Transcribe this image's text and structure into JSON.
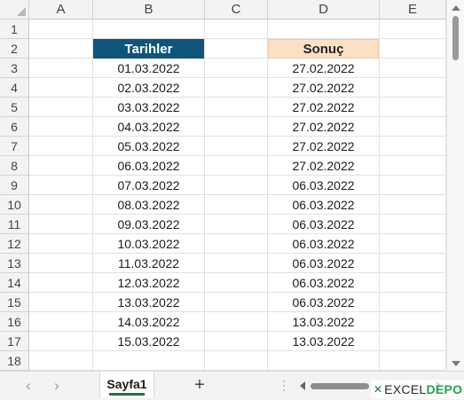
{
  "columns": [
    "A",
    "B",
    "C",
    "D",
    "E"
  ],
  "rows": [
    "1",
    "2",
    "3",
    "4",
    "5",
    "6",
    "7",
    "8",
    "9",
    "10",
    "11",
    "12",
    "13",
    "14",
    "15",
    "16",
    "17",
    "18"
  ],
  "table": {
    "header_b": "Tarihler",
    "header_d": "Sonuç",
    "tarihler": [
      "01.03.2022",
      "02.03.2022",
      "03.03.2022",
      "04.03.2022",
      "05.03.2022",
      "06.03.2022",
      "07.03.2022",
      "08.03.2022",
      "09.03.2022",
      "10.03.2022",
      "11.03.2022",
      "12.03.2022",
      "13.03.2022",
      "14.03.2022",
      "15.03.2022"
    ],
    "sonuc": [
      "27.02.2022",
      "27.02.2022",
      "27.02.2022",
      "27.02.2022",
      "27.02.2022",
      "27.02.2022",
      "06.03.2022",
      "06.03.2022",
      "06.03.2022",
      "06.03.2022",
      "06.03.2022",
      "06.03.2022",
      "06.03.2022",
      "13.03.2022",
      "13.03.2022"
    ]
  },
  "sheet_tab": "Sayfa1",
  "nav": {
    "prev": "‹",
    "next": "›",
    "add": "+",
    "dots": "⋮"
  },
  "watermark": {
    "part1": "EXCEL",
    "part2": "DEPO"
  },
  "colors": {
    "header_b_bg": "#0f5479",
    "header_d_bg": "#fbe0c5",
    "tab_accent": "#217346"
  },
  "icons": [
    "corner-triangle-icon",
    "scroll-up-icon",
    "scroll-down-icon",
    "scroll-left-icon",
    "scroll-right-icon",
    "add-sheet-icon",
    "more-options-icon",
    "excel-logo-icon"
  ]
}
